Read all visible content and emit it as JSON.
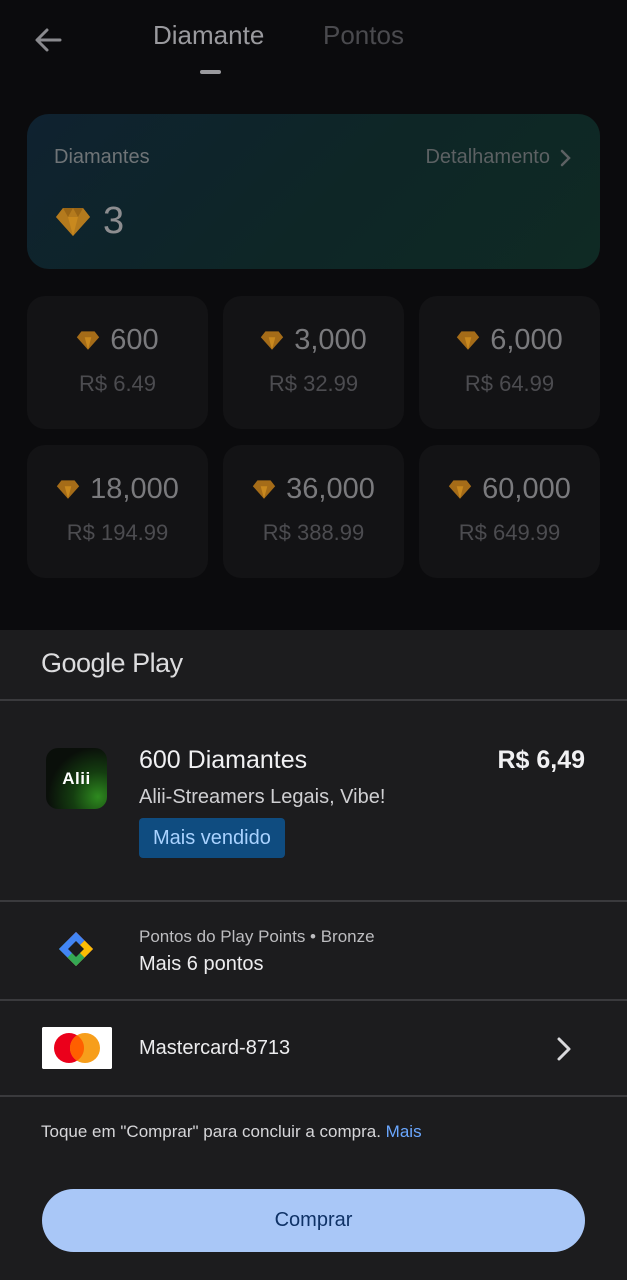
{
  "header": {
    "tabs": [
      {
        "label": "Diamante",
        "active": true
      },
      {
        "label": "Pontos",
        "active": false
      }
    ]
  },
  "balance": {
    "label": "Diamantes",
    "detail_link": "Detalhamento",
    "value": "3"
  },
  "packages": [
    {
      "amount": "600",
      "price": "R$  6.49"
    },
    {
      "amount": "3,000",
      "price": "R$  32.99"
    },
    {
      "amount": "6,000",
      "price": "R$  64.99"
    },
    {
      "amount": "18,000",
      "price": "R$  194.99"
    },
    {
      "amount": "36,000",
      "price": "R$  388.99"
    },
    {
      "amount": "60,000",
      "price": "R$  649.99"
    }
  ],
  "sheet": {
    "brand": "Google Play",
    "product": {
      "icon_text": "Alii",
      "title": "600 Diamantes",
      "price": "R$ 6,49",
      "subtitle": "Alii-Streamers Legais, Vibe!",
      "badge": "Mais vendido"
    },
    "play_points": {
      "title": "Pontos do Play Points • Bronze",
      "value": "Mais 6 pontos"
    },
    "payment": {
      "label": "Mastercard-8713"
    },
    "terms": {
      "text": "Toque em \"Comprar\" para concluir a compra.",
      "link": "Mais"
    },
    "buy_label": "Comprar"
  },
  "colors": {
    "sheet_bg": "#1c1c1e",
    "buy_button_bg": "#a9c7f7",
    "badge_bg": "#0f4c80",
    "link": "#6aa7ff",
    "diamond": "#c9891e"
  },
  "icons": [
    "back-arrow-icon",
    "chevron-right-icon",
    "diamond-icon",
    "play-points-icon",
    "mastercard-icon"
  ]
}
